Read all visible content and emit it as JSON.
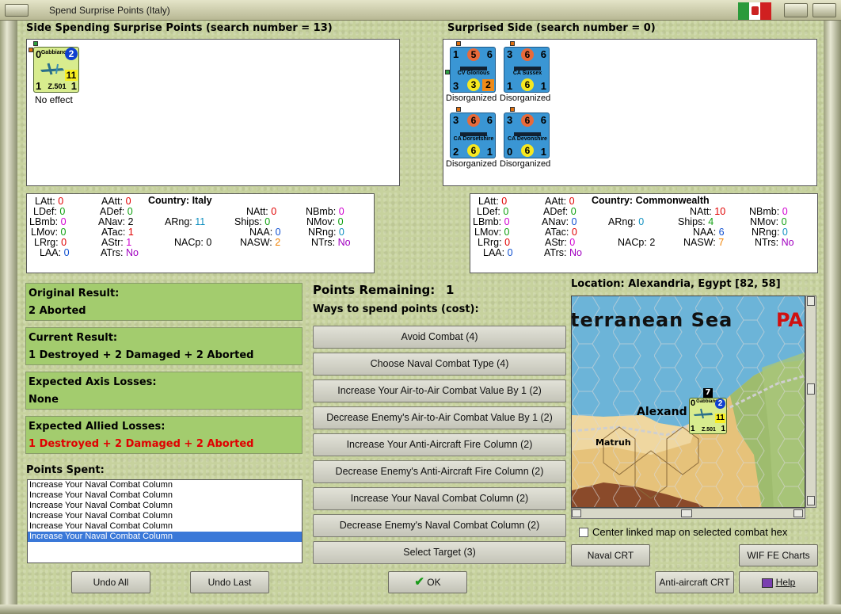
{
  "window": {
    "title": "Spend Surprise Points (Italy)"
  },
  "spending": {
    "heading": "Side Spending Surprise Points (search number = 13)",
    "units": [
      {
        "name": "Gabbiano",
        "type": "Z.501",
        "top_left": "0",
        "top_right": "2",
        "mid_right": "11",
        "bottom_left": "1",
        "bottom_right": "1",
        "status": "No effect"
      }
    ]
  },
  "surprised": {
    "heading": "Surprised Side (search number = 0)",
    "units": [
      {
        "name": "CV Glorious",
        "tl": "1",
        "tc": "5",
        "tr": "6",
        "bl": "3",
        "bc": "3",
        "br": "2",
        "status": "Disorganized"
      },
      {
        "name": "CA Sussex",
        "tl": "3",
        "tc": "6",
        "tr": "6",
        "bl": "1",
        "bc": "6",
        "br": "1",
        "status": "Disorganized"
      },
      {
        "name": "CA Dorsetshire",
        "tl": "3",
        "tc": "6",
        "tr": "6",
        "bl": "2",
        "bc": "6",
        "br": "1",
        "status": "Disorganized"
      },
      {
        "name": "CA Devonshire",
        "tl": "3",
        "tc": "6",
        "tr": "6",
        "bl": "0",
        "bc": "6",
        "br": "1",
        "status": "Disorganized"
      }
    ]
  },
  "stats_axis": {
    "country_label": "Country:",
    "country": "Italy",
    "LAtt": "0",
    "LDef": "0",
    "LBmb": "0",
    "LMov": "0",
    "LRrg": "0",
    "LAA": "0",
    "AAtt": "0",
    "ADef": "0",
    "ANav": "2",
    "ATac": "1",
    "AStr": "1",
    "ATrs": "No",
    "ARng": "11",
    "NACp": "0",
    "NAtt": "0",
    "Ships": "0",
    "NAA": "0",
    "NASW": "2",
    "NBmb": "0",
    "NMov": "0",
    "NRng": "0",
    "NTrs": "No"
  },
  "stats_allied": {
    "country_label": "Country:",
    "country": "Commonwealth",
    "LAtt": "0",
    "LDef": "0",
    "LBmb": "0",
    "LMov": "0",
    "LRrg": "0",
    "LAA": "0",
    "AAtt": "0",
    "ADef": "0",
    "ANav": "0",
    "ATac": "0",
    "AStr": "0",
    "ATrs": "No",
    "ARng": "0",
    "NACp": "2",
    "NAtt": "10",
    "Ships": "4",
    "NAA": "6",
    "NASW": "7",
    "NBmb": "0",
    "NMov": "0",
    "NRng": "0",
    "NTrs": "No"
  },
  "results": {
    "original_label": "Original Result:",
    "original": "2 Aborted",
    "current_label": "Current Result:",
    "current": "1 Destroyed + 2 Damaged + 2 Aborted",
    "axis_label": "Expected Axis Losses:",
    "axis": "None",
    "allied_label": "Expected Allied Losses:",
    "allied": "1 Destroyed + 2 Damaged + 2 Aborted"
  },
  "points": {
    "remaining_label": "Points Remaining:",
    "remaining": "1",
    "ways_label": "Ways to spend points (cost):",
    "spent_label": "Points Spent:",
    "spent": [
      "Increase Your Naval Combat Column",
      "Increase Your Naval Combat Column",
      "Increase Your Naval Combat Column",
      "Increase Your Naval Combat Column",
      "Increase Your Naval Combat Column",
      "Increase Your Naval Combat Column"
    ]
  },
  "actions": [
    "Avoid Combat (4)",
    "Choose Naval Combat Type (4)",
    "Increase Your Air-to-Air Combat Value By 1 (2)",
    "Decrease Enemy's Air-to-Air Combat Value By 1 (2)",
    "Increase Your Anti-Aircraft Fire Column (2)",
    "Decrease Enemy's Anti-Aircraft Fire Column (2)",
    "Increase Your Naval Combat Column (2)",
    "Decrease Enemy's Naval Combat Column (2)",
    "Select Target (3)"
  ],
  "map": {
    "location": "Location: Alexandria, Egypt [82, 58]",
    "sea_label": "terranean Sea",
    "red_label": "PA",
    "city_label": "Alexand",
    "town_label": "Matruh",
    "stack_count": "7",
    "center_label": "Center linked map on selected combat hex"
  },
  "buttons": {
    "undo_all": "Undo All",
    "undo_last": "Undo Last",
    "ok": "OK",
    "naval_crt": "Naval CRT",
    "wif_charts": "WIF FE Charts",
    "aa_crt": "Anti-aircraft CRT",
    "help": "Help"
  },
  "colors": {
    "panel_green": "#a3cc6e",
    "background": "#c7d29e",
    "selected_row": "#3a78d8",
    "loss_red": "#e00000"
  }
}
